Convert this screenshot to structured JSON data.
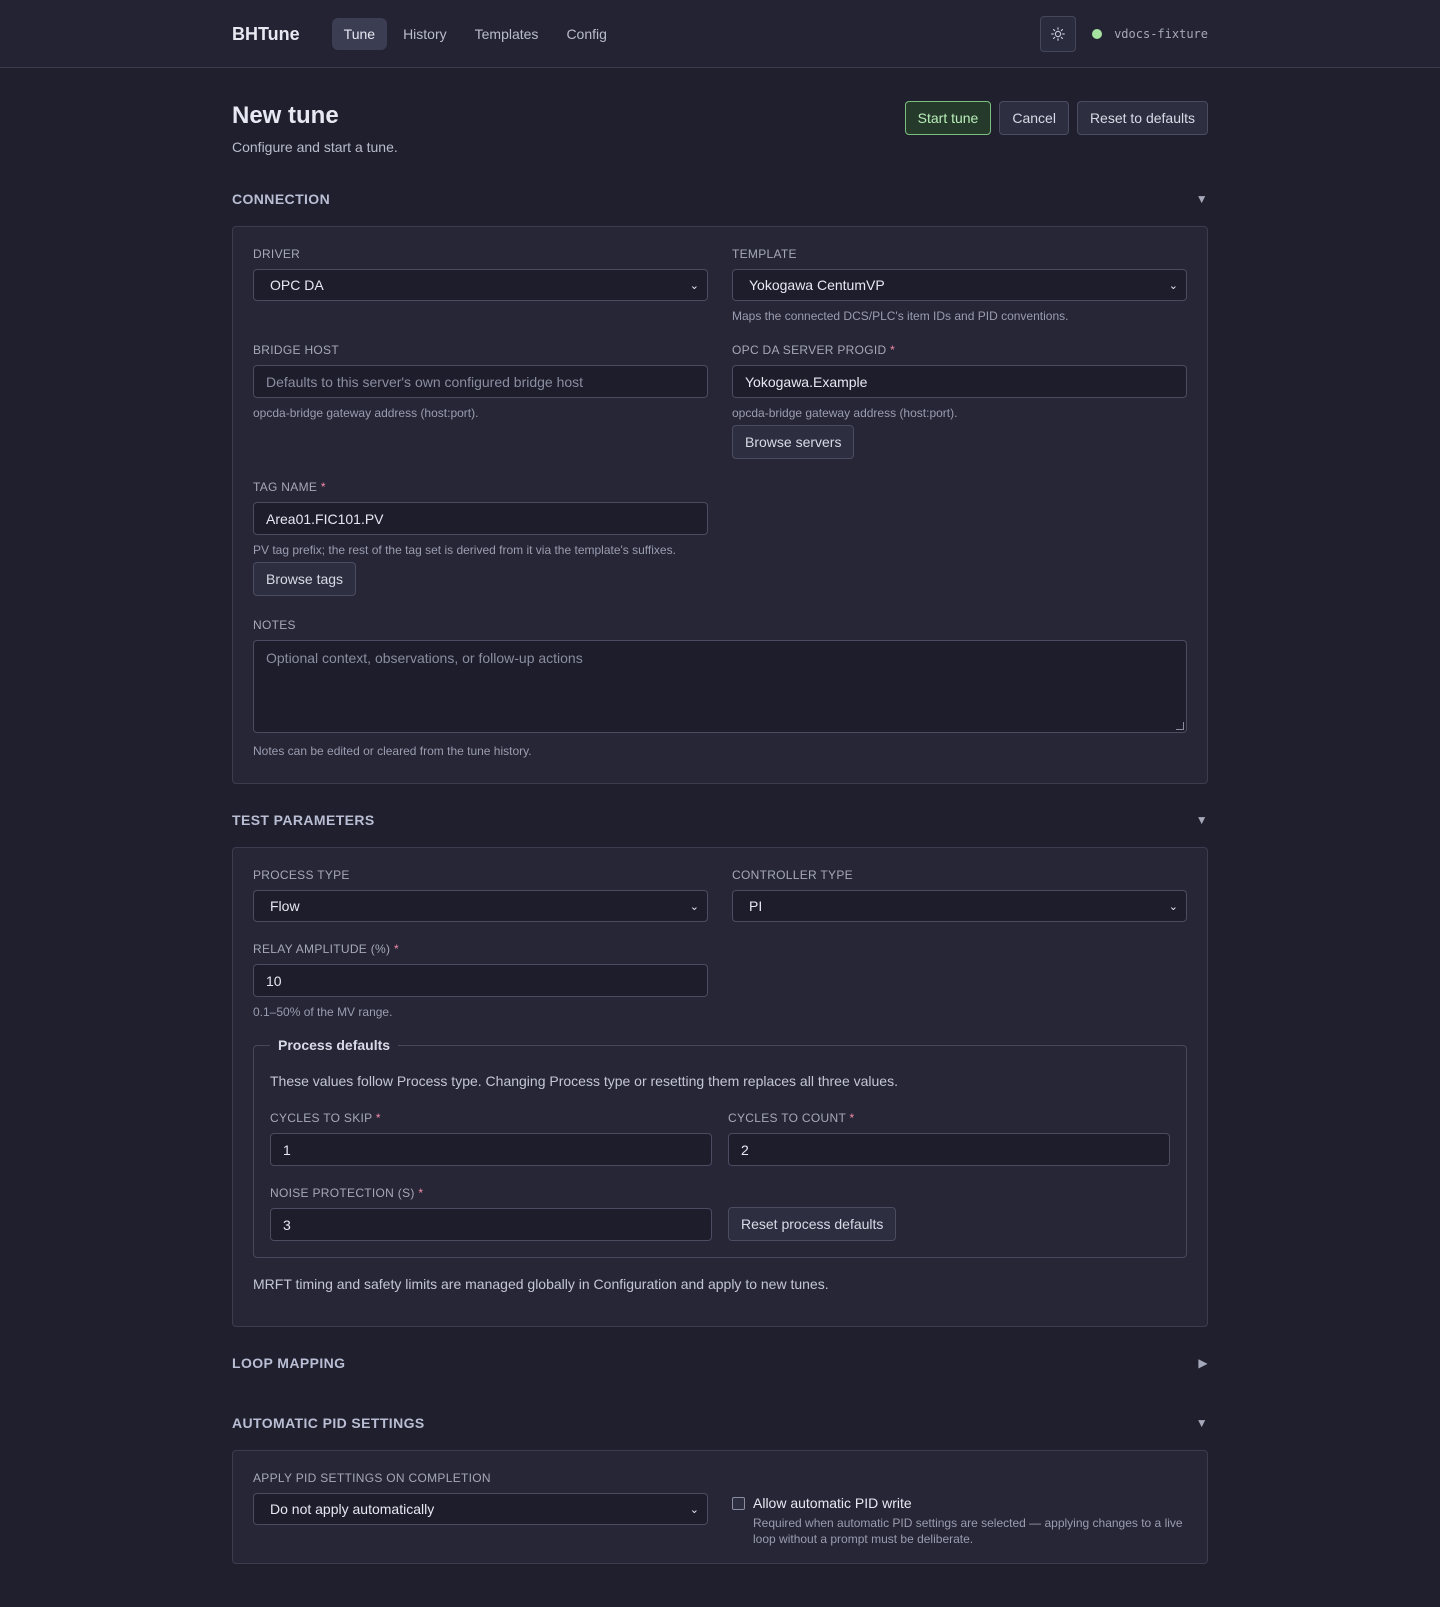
{
  "header": {
    "brand": "BHTune",
    "nav": [
      "Tune",
      "History",
      "Templates",
      "Config"
    ],
    "server": "vdocs-fixture"
  },
  "page": {
    "title": "New tune",
    "subtitle": "Configure and start a tune.",
    "actions": {
      "start": "Start tune",
      "cancel": "Cancel",
      "reset": "Reset to defaults"
    }
  },
  "connection": {
    "heading": "CONNECTION",
    "toggle": "▼",
    "driver_label": "DRIVER",
    "driver_value": "OPC DA",
    "template_label": "TEMPLATE",
    "template_value": "Yokogawa CentumVP",
    "template_hint": "Maps the connected DCS/PLC's item IDs and PID conventions.",
    "bridge_label": "BRIDGE HOST",
    "bridge_placeholder": "Defaults to this server's own configured bridge host",
    "bridge_hint": "opcda-bridge gateway address (host:port).",
    "progid_label": "OPC DA SERVER PROGID",
    "progid_value": "Yokogawa.Example",
    "progid_hint": "opcda-bridge gateway address (host:port).",
    "browse_servers": "Browse servers",
    "tag_label": "TAG NAME",
    "tag_value": "Area01.FIC101.PV",
    "tag_hint": "PV tag prefix; the rest of the tag set is derived from it via the template's suffixes.",
    "browse_tags": "Browse tags",
    "notes_label": "NOTES",
    "notes_placeholder": "Optional context, observations, or follow-up actions",
    "notes_hint": "Notes can be edited or cleared from the tune history."
  },
  "test_parameters": {
    "heading": "TEST PARAMETERS",
    "toggle": "▼",
    "process_type_label": "PROCESS TYPE",
    "process_type_value": "Flow",
    "controller_type_label": "CONTROLLER TYPE",
    "controller_type_value": "PI",
    "relay_label": "RELAY AMPLITUDE (%)",
    "relay_value": "10",
    "relay_hint": "0.1–50% of the MV range.",
    "defaults_legend": "Process defaults",
    "defaults_desc": "These values follow Process type. Changing Process type or resetting them replaces all three values.",
    "skip_label": "CYCLES TO SKIP",
    "skip_value": "1",
    "count_label": "CYCLES TO COUNT",
    "count_value": "2",
    "noise_label": "NOISE PROTECTION (S)",
    "noise_value": "3",
    "reset_process": "Reset process defaults",
    "mrft_note": "MRFT timing and safety limits are managed globally in Configuration and apply to new tunes."
  },
  "loop_mapping": {
    "heading": "LOOP MAPPING",
    "toggle": "▶"
  },
  "auto_pid": {
    "heading": "AUTOMATIC PID SETTINGS",
    "toggle": "▼",
    "apply_label": "APPLY PID SETTINGS ON COMPLETION",
    "apply_value": "Do not apply automatically",
    "allow_label": "Allow automatic PID write",
    "allow_checked": false,
    "allow_hint": "Required when automatic PID settings are selected — applying changes to a live loop without a prompt must be deliberate."
  },
  "common": {
    "required_mark": "*",
    "select_chevron": "⌄"
  },
  "colors": {
    "background": "#1f1f2d",
    "card": "#262636",
    "accent_green": "#a6e3a1",
    "required": "#f38ba8"
  }
}
